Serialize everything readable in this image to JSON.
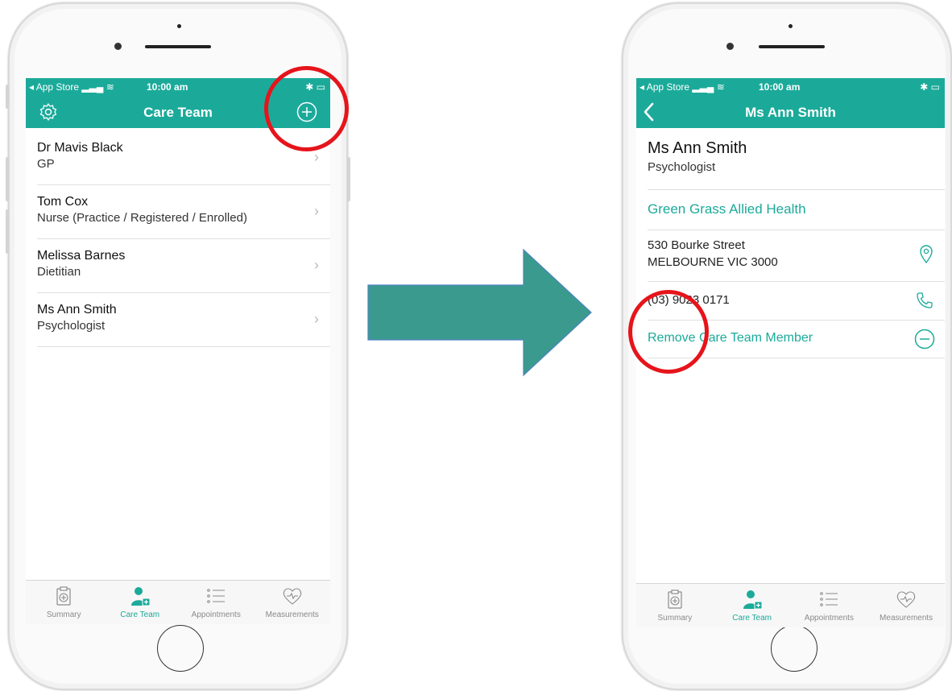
{
  "left_phone": {
    "status": {
      "back_label": "App Store",
      "time": "10:00 am"
    },
    "nav": {
      "title": "Care Team"
    },
    "members": [
      {
        "name": "Dr Mavis Black",
        "role": "GP"
      },
      {
        "name": "Tom Cox",
        "role": "Nurse (Practice / Registered / Enrolled)"
      },
      {
        "name": "Melissa Barnes",
        "role": "Dietitian"
      },
      {
        "name": "Ms Ann Smith",
        "role": "Psychologist"
      }
    ],
    "tabs": [
      {
        "label": "Summary",
        "icon": "clipboard-icon"
      },
      {
        "label": "Care Team",
        "icon": "care-team-icon",
        "active": true
      },
      {
        "label": "Appointments",
        "icon": "list-icon"
      },
      {
        "label": "Measurements",
        "icon": "heart-pulse-icon"
      }
    ]
  },
  "right_phone": {
    "status": {
      "back_label": "App Store",
      "time": "10:00 am"
    },
    "nav": {
      "title": "Ms Ann Smith"
    },
    "detail": {
      "name": "Ms Ann Smith",
      "role": "Psychologist",
      "organisation": "Green Grass Allied Health",
      "address_line1": "530 Bourke Street",
      "address_line2": "MELBOURNE  VIC  3000",
      "phone": "(03) 9023 0171",
      "remove_label": "Remove Care Team Member"
    },
    "tabs": [
      {
        "label": "Summary",
        "icon": "clipboard-icon"
      },
      {
        "label": "Care Team",
        "icon": "care-team-icon",
        "active": true
      },
      {
        "label": "Appointments",
        "icon": "list-icon"
      },
      {
        "label": "Measurements",
        "icon": "heart-pulse-icon"
      }
    ]
  },
  "colors": {
    "accent": "#1baa9a",
    "annotation": "#e6141b",
    "arrow": "#3a9a8e"
  }
}
